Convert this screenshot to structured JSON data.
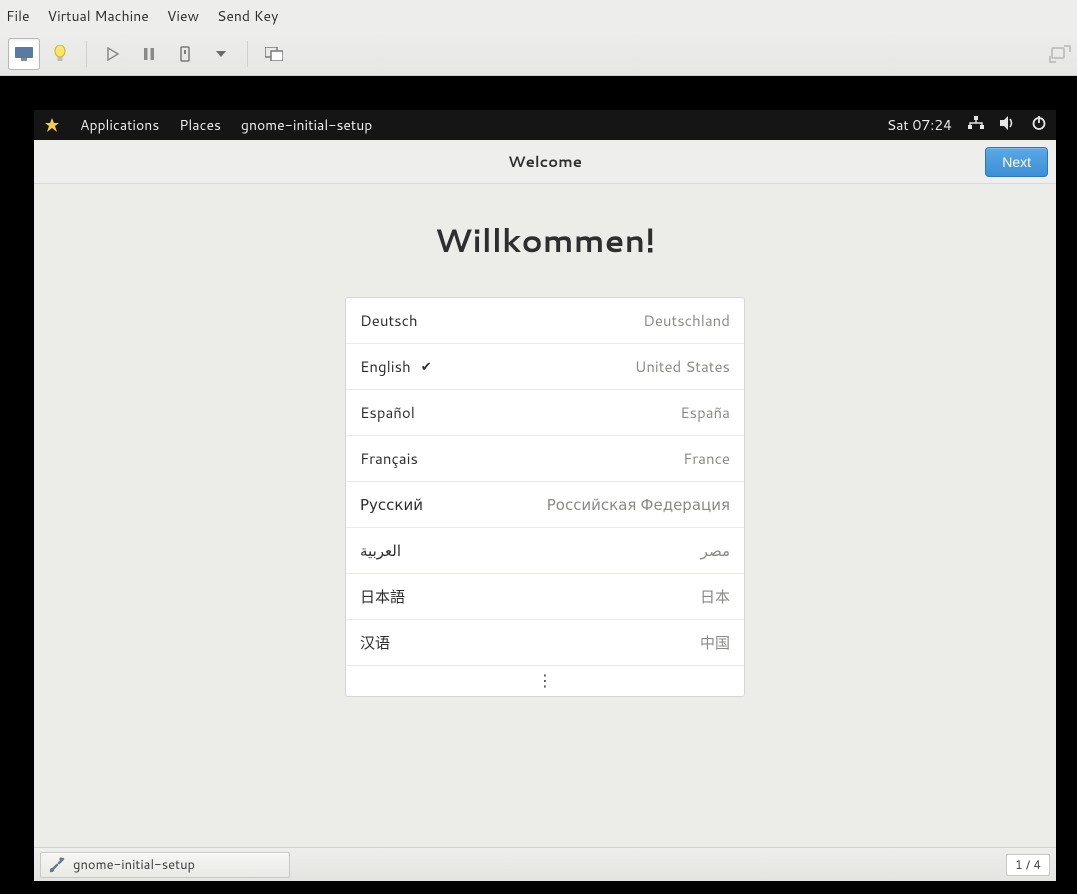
{
  "host": {
    "menus": [
      "File",
      "Virtual Machine",
      "View",
      "Send Key"
    ]
  },
  "guest": {
    "topbar": {
      "applications": "Applications",
      "places": "Places",
      "app_name": "gnome-initial-setup",
      "clock": "Sat 07:24"
    },
    "header": {
      "title": "Welcome",
      "next": "Next"
    },
    "heading": "Willkommen!",
    "languages": [
      {
        "name": "Deutsch",
        "region": "Deutschland",
        "selected": false
      },
      {
        "name": "English",
        "region": "United States",
        "selected": true
      },
      {
        "name": "Español",
        "region": "España",
        "selected": false
      },
      {
        "name": "Français",
        "region": "France",
        "selected": false
      },
      {
        "name": "Русский",
        "region": "Российская Федерация",
        "selected": false
      },
      {
        "name": "العربية",
        "region": "مصر",
        "selected": false
      },
      {
        "name": "日本語",
        "region": "日本",
        "selected": false
      },
      {
        "name": "汉语",
        "region": "中国",
        "selected": false
      }
    ],
    "taskbar": {
      "task": "gnome-initial-setup",
      "pager": "1 / 4"
    }
  }
}
